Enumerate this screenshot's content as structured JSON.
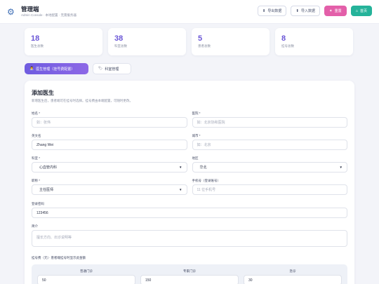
{
  "header": {
    "title": "管理端",
    "subtitle": "Admin Console · 本地配置 · 无需服务器",
    "logo_icon": "gear-icon",
    "buttons": {
      "export": "导出数据",
      "import": "导入数据",
      "reset": "重置",
      "home": "首页"
    }
  },
  "stats": [
    {
      "value": "18",
      "label": "医生总数"
    },
    {
      "value": "38",
      "label": "科室总数"
    },
    {
      "value": "5",
      "label": "患者总数"
    },
    {
      "value": "8",
      "label": "挂号总数"
    }
  ],
  "tabs": {
    "doctors": "医生管理（挂号费配置）",
    "departments": "科室管理"
  },
  "form": {
    "title": "添加医生",
    "description": "新增医生后，患者端可在挂号时选择。挂号费由本端配置，可随时更改。",
    "name": {
      "label": "姓名 *",
      "placeholder": "如：张伟"
    },
    "hospital": {
      "label": "医院 *",
      "placeholder": "如：北京协和医院"
    },
    "english_name": {
      "label": "英文名",
      "value": "Zhang Wei"
    },
    "city": {
      "label": "城市 *",
      "placeholder": "如：北京"
    },
    "department": {
      "label": "科室 *",
      "value": "心血管内科"
    },
    "region": {
      "label": "地区",
      "value": "华北"
    },
    "title_field": {
      "label": "职称 *",
      "value": "主任医师"
    },
    "phone": {
      "label": "手机号（登录账号）",
      "placeholder": "11 位手机号"
    },
    "password": {
      "label": "登录密码",
      "value": "123456"
    },
    "intro": {
      "label": "简介",
      "placeholder": "擅长方向、出诊说明等"
    },
    "fee_section_label": "挂号费（元）· 患者端挂号时显示此金额",
    "fees": [
      {
        "label": "普通门诊",
        "value": "50"
      },
      {
        "label": "专家门诊",
        "value": "150"
      },
      {
        "label": "急诊",
        "value": "30"
      }
    ]
  }
}
